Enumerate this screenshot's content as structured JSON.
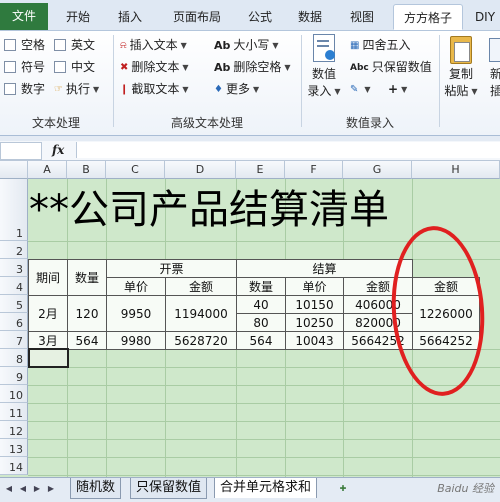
{
  "ribbon_tabs": [
    "文件",
    "开始",
    "插入",
    "页面布局",
    "公式",
    "数据",
    "视图",
    "方方格子",
    "DIY"
  ],
  "ribbon": {
    "text_group": {
      "label": "文本处理",
      "checkboxes": [
        "空格",
        "英文",
        "符号",
        "中文",
        "数字"
      ],
      "execute": "执行"
    },
    "advanced_group": {
      "label": "高级文本处理",
      "items": [
        "插入文本",
        "删除文本",
        "截取文本",
        "大小写",
        "删除空格",
        "更多"
      ]
    },
    "numeric_group": {
      "label": "数值录入",
      "numeric_entry": [
        "数值",
        "录入"
      ],
      "round": "四舍五入",
      "keep_values": "只保留数值",
      "plus": "+"
    },
    "copy_paste": [
      "复制",
      "粘贴"
    ],
    "new_insert": [
      "新",
      "插"
    ]
  },
  "formula_bar": {
    "fx": "fx",
    "name_box": "",
    "content": ""
  },
  "columns": [
    "A",
    "B",
    "C",
    "D",
    "E",
    "F",
    "G",
    "H"
  ],
  "rows": [
    "1",
    "2",
    "3",
    "4",
    "5",
    "6",
    "7",
    "8",
    "9",
    "10",
    "11",
    "12",
    "13",
    "14"
  ],
  "table": {
    "title": "**公司产品结算清单",
    "period": "期间",
    "qty": "数量",
    "invoice": "开票",
    "settlement": "结算",
    "unit_price": "单价",
    "amount": "金额",
    "inv_unit_price": "单价",
    "inv_amount": "金额",
    "set_qty": "数量",
    "set_unit_price": "单价",
    "set_amount": "金额",
    "h_amount": "金额",
    "feb": {
      "period": "2月",
      "qty": "120",
      "unit_price": "9950",
      "amount": "1194000",
      "s_qty_1": "40",
      "s_price_1": "10150",
      "s_amount_1": "406000",
      "s_qty_2": "80",
      "s_price_2": "10250",
      "s_amount_2": "820000",
      "total": "1226000"
    },
    "mar": {
      "period": "3月",
      "qty": "564",
      "unit_price": "9980",
      "amount": "5628720",
      "s_qty": "564",
      "s_price": "10043",
      "s_amount": "5664252",
      "total": "5664252"
    }
  },
  "sheet_tabs": [
    "随机数",
    "只保留数值",
    "合并单元格求和"
  ],
  "active_sheet": "合并单元格求和",
  "watermark": "Baidu 经验",
  "colors": {
    "file_tab": "#2f7a3e",
    "sheet_bg": "#cfe8cb",
    "annotation": "#e02020"
  }
}
